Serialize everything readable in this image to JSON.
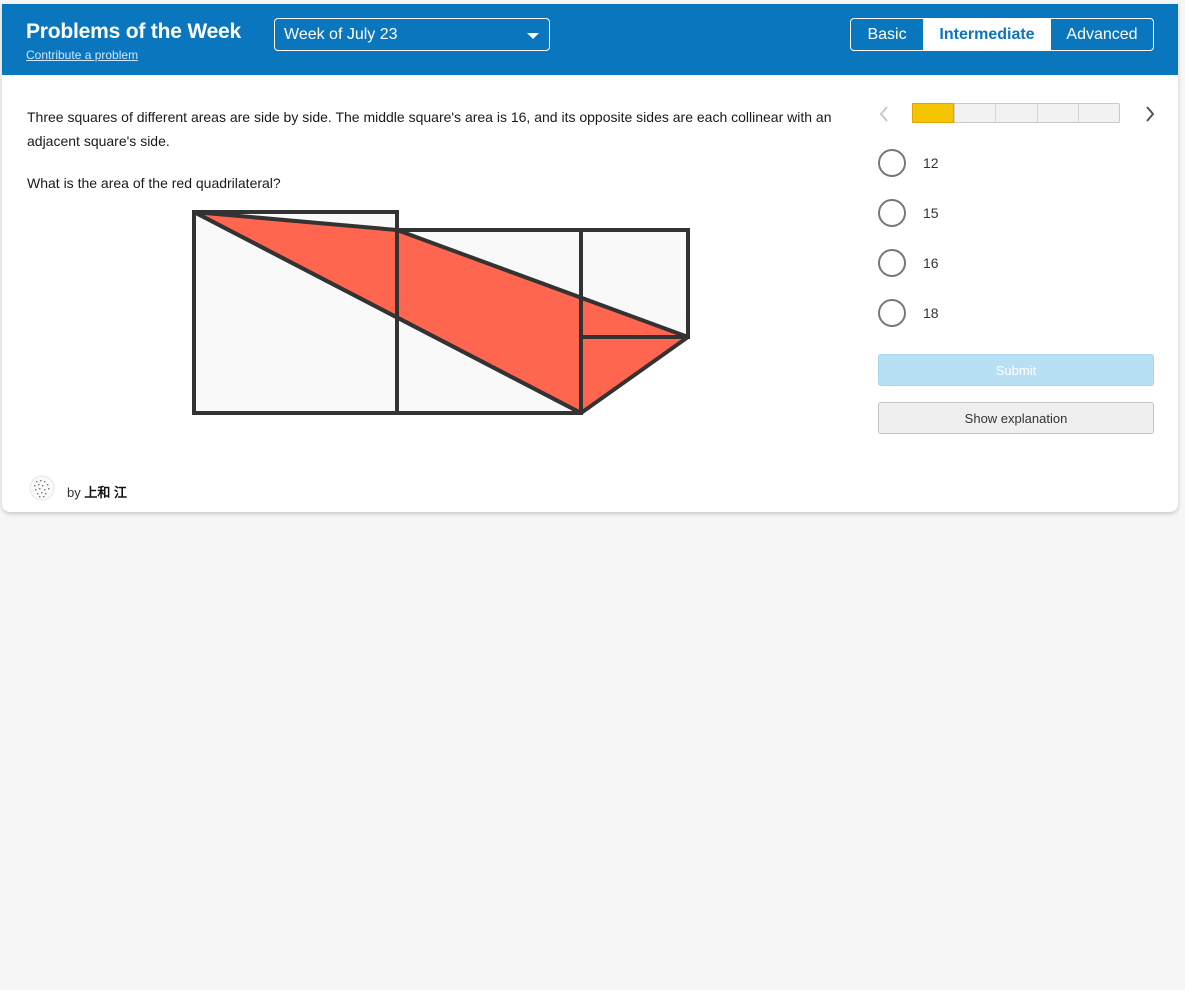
{
  "header": {
    "title": "Problems of the Week",
    "contribute_link": "Contribute a problem",
    "week_select": {
      "selected": "Week of July 23",
      "icon": "chevron-down-icon"
    },
    "levels": [
      {
        "label": "Basic",
        "active": false
      },
      {
        "label": "Intermediate",
        "active": true
      },
      {
        "label": "Advanced",
        "active": false
      }
    ]
  },
  "problem": {
    "text": "Three squares of different areas are side by side. The middle square's area is 16, and its opposite sides are each collinear with an adjacent square's side.",
    "prompt": "What is the area of the red quadrilateral?",
    "figure_colors": {
      "fill": "#ff6650",
      "square_fill": "#f9f9f9",
      "stroke": "#333333"
    }
  },
  "navigation": {
    "prev_icon": "chevron-left-icon",
    "next_icon": "chevron-right-icon",
    "progress": {
      "total": 5,
      "current": 1,
      "current_color": "#f5c400"
    }
  },
  "choices": [
    {
      "label": "12"
    },
    {
      "label": "15"
    },
    {
      "label": "16"
    },
    {
      "label": "18"
    }
  ],
  "actions": {
    "submit": "Submit",
    "show_explanation": "Show explanation"
  },
  "author": {
    "prefix": "by",
    "name": "上和 江",
    "avatar_icon": "user-avatar-icon"
  },
  "colors": {
    "header_bg": "#0a76be",
    "page_bg": "#f6f6f6"
  }
}
